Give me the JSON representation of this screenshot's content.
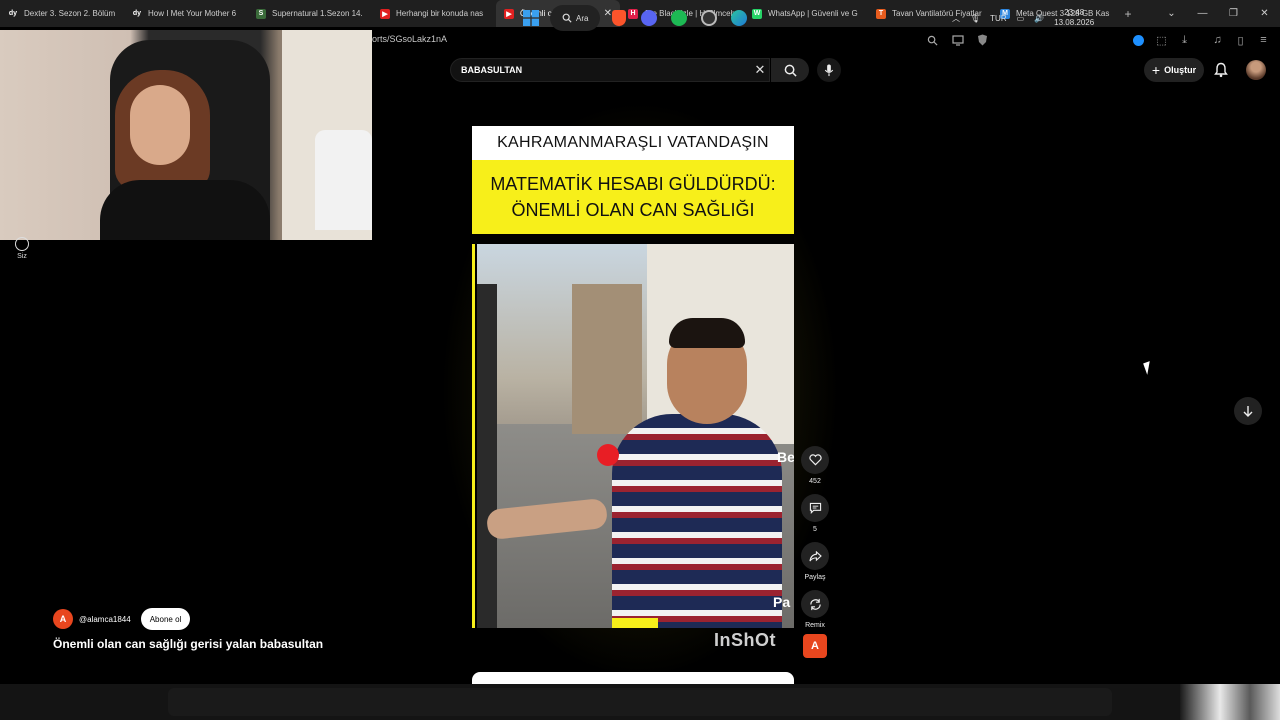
{
  "browser": {
    "tabs": [
      {
        "label": "Dexter 3. Sezon 2. Bölüm",
        "favicon": "dy",
        "color": "#1f1f1f"
      },
      {
        "label": "How I Met Your Mother 6",
        "favicon": "dy",
        "color": "#1f1f1f"
      },
      {
        "label": "Supernatural 1.Sezon 14.",
        "favicon": "S",
        "color": "#3a6b3a"
      },
      {
        "label": "Herhangi bir konuda nas",
        "favicon": "▶",
        "color": "#e02020"
      },
      {
        "label": "Önemli olan can s",
        "favicon": "▶",
        "color": "#e02020",
        "active": true
      },
      {
        "label": "Joe Black izle | Hdfilmceh",
        "favicon": "H",
        "color": "#e0204a"
      },
      {
        "label": "WhatsApp | Güvenli ve G",
        "favicon": "W",
        "color": "#25d366"
      },
      {
        "label": "Tavan Vantilatörü Fiyatlar",
        "favicon": "T",
        "color": "#e65c1e"
      },
      {
        "label": "Meta Quest 3 128 GB Kas",
        "favicon": "M",
        "color": "#2e86de"
      }
    ],
    "address_fragment": "orts/SGsoLakz1nA"
  },
  "youtube": {
    "search_value": "BABASULTAN",
    "create_label": "Oluştur"
  },
  "sidebar": {
    "you_label": "Siz"
  },
  "short": {
    "headline_top": "KAHRAMANMARAŞLI VATANDAŞIN",
    "headline_line1": "MATEMATİK HESABI GÜLDÜRDÜ:",
    "headline_line2": "ÖNEMLİ OLAN CAN SAĞLIĞI",
    "side_text_be": "Be",
    "side_text_pa": "Pa",
    "watermark": "InShOt",
    "channel_initial": "A",
    "channel_handle": "@alamca1844",
    "subscribe_label": "Abone ol",
    "title": "Önemli olan can sağlığı gerisi yalan babasultan",
    "actions": {
      "likes": "452",
      "comments": "5",
      "share": "Paylaş",
      "remix": "Remix"
    }
  },
  "taskbar": {
    "search_label": "Ara",
    "language": "TUR",
    "time": "23:48",
    "date": "13.08.2026"
  },
  "colors": {
    "accent_red": "#e81e25",
    "headline_yellow": "#f7ef1a",
    "channel_orange": "#e8461e"
  }
}
